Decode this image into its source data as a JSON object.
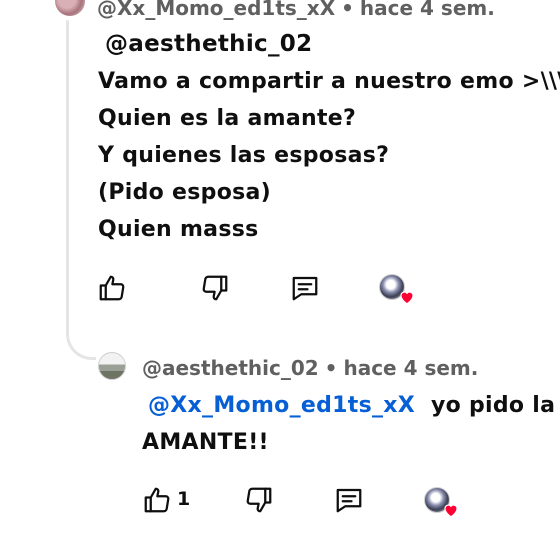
{
  "top_comment": {
    "author": "@Xx_Momo_ed1ts_xX",
    "time": "hace 4 sem.",
    "mention": "@aesthethic_02",
    "lines": [
      "Vamo a compartir a nuestro emo >\\\\\\",
      "Quien es la amante?",
      "Y quienes las esposas?",
      "(Pido esposa)",
      "Quien masss"
    ],
    "actions": {
      "like_icon": "thumbs-up-icon",
      "dislike_icon": "thumbs-down-icon",
      "reply_icon": "comment-icon",
      "creator_heart": "heart-icon"
    }
  },
  "reply": {
    "author": "@aesthethic_02",
    "time": "hace 4 sem.",
    "mention": "@Xx_Momo_ed1ts_xX",
    "text_after_mention": "yo pido la",
    "line2": "AMANTE!!",
    "like_count": "1",
    "actions": {
      "like_icon": "thumbs-up-icon",
      "dislike_icon": "thumbs-down-icon",
      "reply_icon": "comment-icon",
      "creator_heart": "heart-icon"
    }
  },
  "separator": "•",
  "colors": {
    "mention": "#065fd4",
    "meta": "#606060",
    "text": "#0f0f0f",
    "heart": "#ff0033",
    "thread": "#e5e5e5"
  }
}
